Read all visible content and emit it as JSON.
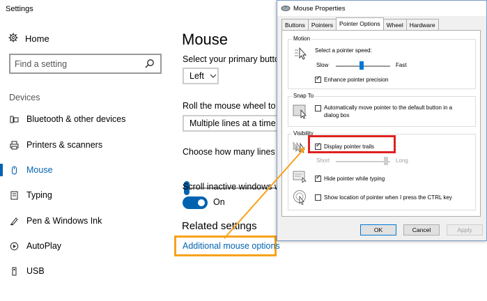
{
  "settings": {
    "window_title": "Settings",
    "home_label": "Home",
    "search_placeholder": "Find a setting",
    "section_label": "Devices",
    "nav_items": [
      {
        "label": "Bluetooth & other devices"
      },
      {
        "label": "Printers & scanners"
      },
      {
        "label": "Mouse"
      },
      {
        "label": "Typing"
      },
      {
        "label": "Pen & Windows Ink"
      },
      {
        "label": "AutoPlay"
      },
      {
        "label": "USB"
      }
    ],
    "page_title": "Mouse",
    "primary_button_label": "Select your primary button",
    "primary_button_value": "Left",
    "scroll_label": "Roll the mouse wheel to scroll",
    "scroll_value": "Multiple lines at a time",
    "lines_label": "Choose how many lines to scroll each time",
    "inactive_label": "Scroll inactive windows when I hover over them",
    "inactive_state": "On",
    "related_title": "Related settings",
    "additional_link": "Additional mouse options"
  },
  "dialog": {
    "title": "Mouse Properties",
    "tabs": [
      "Buttons",
      "Pointers",
      "Pointer Options",
      "Wheel",
      "Hardware"
    ],
    "active_tab": "Pointer Options",
    "motion": {
      "group_label": "Motion",
      "speed_label": "Select a pointer speed:",
      "slow": "Slow",
      "fast": "Fast",
      "speed_level_fraction": 0.45,
      "precision_label": "Enhance pointer precision",
      "precision_checked": true
    },
    "snap_to": {
      "group_label": "Snap To",
      "auto_label_line1": "Automatically move pointer to the default button in a",
      "auto_label_line2": "dialog box",
      "auto_checked": false
    },
    "visibility": {
      "group_label": "Visibility",
      "trails_label": "Display pointer trails",
      "trails_checked": true,
      "short": "Short",
      "long": "Long",
      "trail_level_fraction": 0.9,
      "hide_label": "Hide pointer while typing",
      "hide_checked": true,
      "ctrl_label": "Show location of pointer when I press the CTRL key",
      "ctrl_checked": false
    },
    "buttons": {
      "ok": "OK",
      "cancel": "Cancel",
      "apply": "Apply"
    }
  },
  "colors": {
    "accent": "#0063b1",
    "highlight_orange": "#f7a21b",
    "highlight_red": "#e02020"
  }
}
